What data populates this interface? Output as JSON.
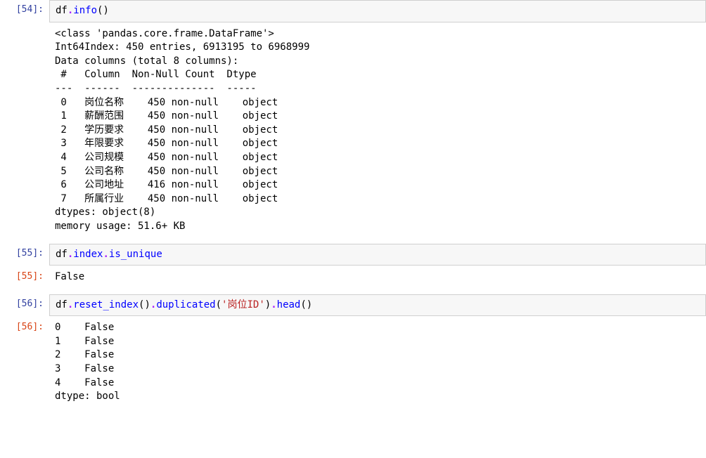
{
  "cells": {
    "c54": {
      "in_prompt": "[54]:",
      "out_prompt": "",
      "code": {
        "var": "df",
        "dot": ".",
        "method": "info",
        "open": "(",
        "close": ")"
      },
      "output": "<class 'pandas.core.frame.DataFrame'>\nInt64Index: 450 entries, 6913195 to 6968999\nData columns (total 8 columns):\n #   Column  Non-Null Count  Dtype \n---  ------  --------------  ----- \n 0   岗位名称    450 non-null    object\n 1   薪酬范围    450 non-null    object\n 2   学历要求    450 non-null    object\n 3   年限要求    450 non-null    object\n 4   公司规模    450 non-null    object\n 5   公司名称    450 non-null    object\n 6   公司地址    416 non-null    object\n 7   所属行业    450 non-null    object\ndtypes: object(8)\nmemory usage: 51.6+ KB"
    },
    "c55": {
      "in_prompt": "[55]:",
      "out_prompt": "[55]:",
      "code": {
        "var1": "df",
        "dot1": ".",
        "attr1": "index",
        "dot2": ".",
        "attr2": "is_unique"
      },
      "output": "False"
    },
    "c56": {
      "in_prompt": "[56]:",
      "out_prompt": "[56]:",
      "code": {
        "var": "df",
        "dot1": ".",
        "m1": "reset_index",
        "p1": "()",
        "dot2": ".",
        "m2": "duplicated",
        "p2o": "(",
        "str": "'岗位ID'",
        "p2c": ")",
        "dot3": ".",
        "m3": "head",
        "p3": "()"
      },
      "output": "0    False\n1    False\n2    False\n3    False\n4    False\ndtype: bool"
    }
  }
}
